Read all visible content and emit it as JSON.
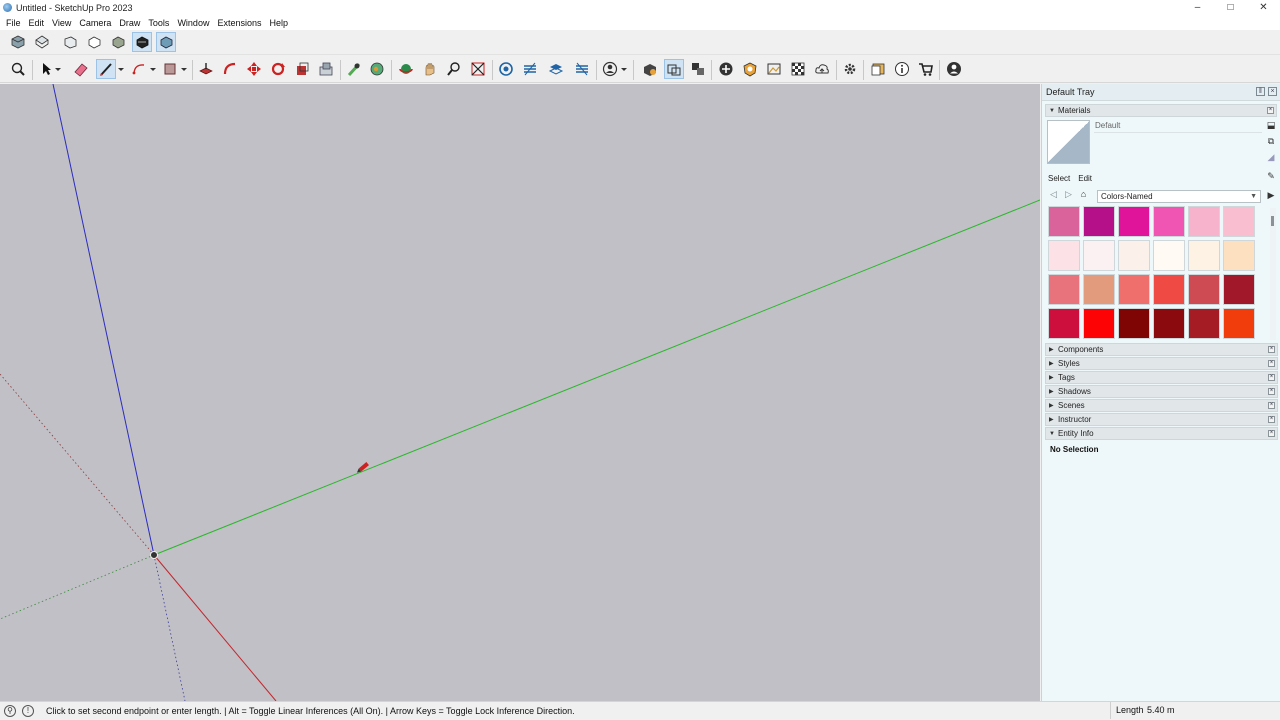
{
  "window": {
    "title": "Untitled - SketchUp Pro 2023",
    "controls": {
      "minimize": "–",
      "maximize": "□",
      "close": "✕"
    }
  },
  "menu": [
    "File",
    "Edit",
    "View",
    "Camera",
    "Draw",
    "Tools",
    "Window",
    "Extensions",
    "Help"
  ],
  "toolbar_views": [
    "iso-view-icon",
    "top-view-icon",
    "front-view-icon",
    "right-view-icon",
    "back-view-icon",
    "left-view-icon",
    "bottom-view-icon"
  ],
  "toolbar_tools": [
    "zoom-icon",
    "select-icon",
    "eraser-icon",
    "line-icon",
    "arc-icon",
    "rectangle-icon",
    "push-pull-icon",
    "follow-me-icon",
    "move-icon",
    "rotate-icon",
    "scale-icon",
    "offset-icon",
    "tape-measure-icon",
    "paint-bucket-icon",
    "orbit-icon",
    "pan-icon",
    "zoom-window-icon",
    "zoom-extents-icon",
    "section-plane-icon",
    "display-section-planes-icon",
    "section-cuts-icon",
    "section-fill-icon",
    "account-icon",
    "warehouse-icon",
    "extension-manager-icon",
    "styles-icon",
    "add-location-icon",
    "geo-icon",
    "photo-texture-icon",
    "xray-icon",
    "cloud-icon",
    "settings-icon",
    "tray-icon",
    "info-icon",
    "cart-icon",
    "profile-icon"
  ],
  "viewport": {
    "background": "#c0c0c6"
  },
  "tray": {
    "title": "Default Tray",
    "materials": {
      "header": "Materials",
      "current_name": "Default",
      "tabs": {
        "select": "Select",
        "edit": "Edit"
      },
      "library": "Colors-Named",
      "swatches": [
        "#d9639a",
        "#b5108a",
        "#e0149b",
        "#f155b3",
        "#f8b3cc",
        "#f9bfd0",
        "#fce2e6",
        "#fbf0f2",
        "#fbf1ea",
        "#fffaf3",
        "#fdf2e4",
        "#fce0c0",
        "#e8737d",
        "#e39b7e",
        "#ef6f6d",
        "#f04a45",
        "#cf4b54",
        "#a0182a",
        "#cd0f3e",
        "#fd0305",
        "#7f0404",
        "#8a0a0e",
        "#a61c24",
        "#f13c0c"
      ]
    },
    "panels": [
      "Components",
      "Styles",
      "Tags",
      "Shadows",
      "Scenes",
      "Instructor",
      "Entity Info"
    ],
    "entity_info": {
      "text": "No Selection"
    }
  },
  "status": {
    "message": "Click to set second endpoint or enter length. | Alt = Toggle Linear Inferences (All On). | Arrow Keys = Toggle Lock Inference Direction.",
    "vcb_label": "Length",
    "vcb_value": "5.40 m"
  }
}
